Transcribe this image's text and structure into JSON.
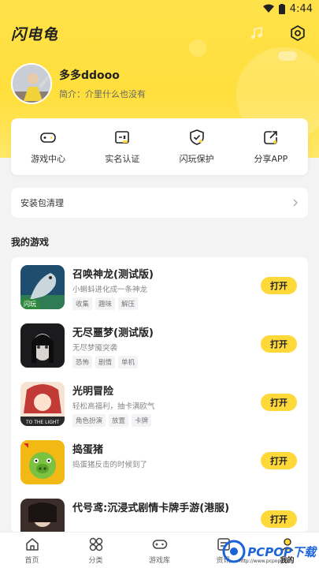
{
  "status": {
    "time": "4:44"
  },
  "header": {
    "title": "闪电龟"
  },
  "profile": {
    "username": "多多ddooo",
    "bio": "简介：介里什么也没有"
  },
  "quick_actions": [
    {
      "label": "游戏中心",
      "icon": "gamepad-icon"
    },
    {
      "label": "实名认证",
      "icon": "id-card-icon"
    },
    {
      "label": "闪玩保护",
      "icon": "shield-check-icon"
    },
    {
      "label": "分享APP",
      "icon": "share-icon"
    }
  ],
  "cleanup": {
    "label": "安装包清理"
  },
  "my_games": {
    "title": "我的游戏",
    "open_label": "打开",
    "items": [
      {
        "name": "召唤神龙(测试版)",
        "desc": "小蝌蚪进化成一条神龙",
        "tags": [
          "收集",
          "趣味",
          "解压"
        ],
        "badge": "闪玩"
      },
      {
        "name": "无尽噩梦(测试版)",
        "desc": "无尽梦魇突袭",
        "tags": [
          "恐怖",
          "剧情",
          "单机"
        ]
      },
      {
        "name": "光明冒险",
        "desc": "轻松高福利，抽卡满欧气",
        "tags": [
          "角色扮演",
          "放置",
          "卡牌"
        ],
        "icon_caption": "TO THE LIGHT"
      },
      {
        "name": "捣蛋猪",
        "desc": "捣蛋猪反击的时候到了",
        "tags": []
      },
      {
        "name": "代号鸢:沉浸式剧情卡牌手游(港服)",
        "desc": "",
        "tags": []
      }
    ]
  },
  "tabbar": [
    {
      "label": "首页",
      "icon": "home-icon"
    },
    {
      "label": "分类",
      "icon": "category-grid-icon"
    },
    {
      "label": "游戏库",
      "icon": "gamepad-icon"
    },
    {
      "label": "资讯",
      "icon": "news-icon"
    },
    {
      "label": "我的",
      "icon": "profile-icon"
    }
  ],
  "watermark": {
    "text": "PCPOP下载",
    "sub": "http://www.pcpop.com"
  },
  "colors": {
    "accent": "#ffd93a",
    "hero_bg": "#ffe24a"
  }
}
